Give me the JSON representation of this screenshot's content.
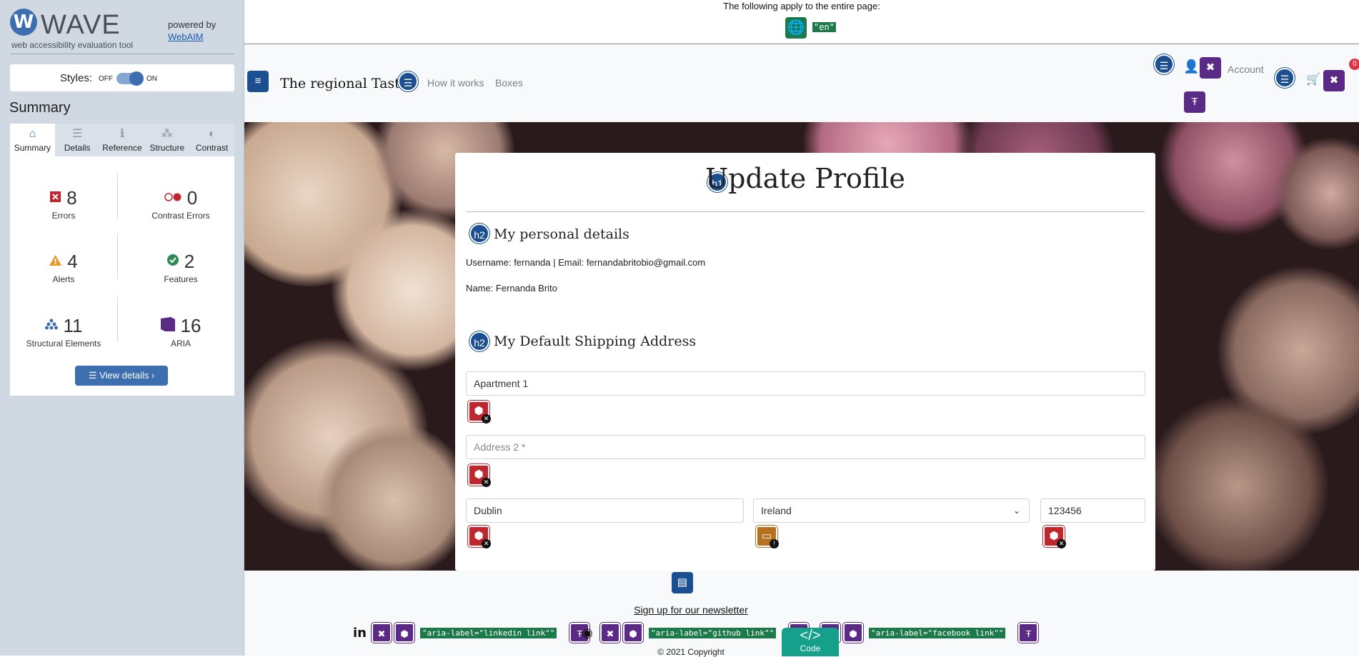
{
  "wave": {
    "logo_letter": "W",
    "logo_name": "WAVE",
    "tagline": "web accessibility evaluation tool",
    "powered_by": "powered by",
    "webaim_link": "WebAIM",
    "styles_label": "Styles:",
    "styles_off": "OFF",
    "styles_on": "ON",
    "summary_title": "Summary",
    "tabs": [
      {
        "label": "Summary",
        "icon": "home-icon"
      },
      {
        "label": "Details",
        "icon": "list-icon"
      },
      {
        "label": "Reference",
        "icon": "info-icon"
      },
      {
        "label": "Structure",
        "icon": "structure-icon"
      },
      {
        "label": "Contrast",
        "icon": "contrast-icon"
      }
    ],
    "stats": {
      "errors": {
        "value": "8",
        "label": "Errors"
      },
      "contrast_errors": {
        "value": "0",
        "label": "Contrast Errors"
      },
      "alerts": {
        "value": "4",
        "label": "Alerts"
      },
      "features": {
        "value": "2",
        "label": "Features"
      },
      "structural": {
        "value": "11",
        "label": "Structural Elements"
      },
      "aria": {
        "value": "16",
        "label": "ARIA"
      }
    },
    "view_details": "View details ›"
  },
  "page_level": {
    "text": "The following apply to the entire page:",
    "lang": "\"en\""
  },
  "nav": {
    "brand": "The regional Taste",
    "how_it_works": "How it works",
    "boxes": "Boxes",
    "account": "Account",
    "cart_count": "0"
  },
  "form": {
    "h1_tag": "h1",
    "h2_tag": "h2",
    "title": "Update Profile",
    "personal_heading": "My personal details",
    "username_line": "Username: fernanda | Email: fernandabritobio@gmail.com",
    "name_line": "Name: Fernanda Brito",
    "shipping_heading": "My Default Shipping Address",
    "address1_value": "Apartment 1",
    "address2_placeholder": "Address 2 *",
    "city_value": "Dublin",
    "country_value": "Ireland",
    "postcode_value": "123456"
  },
  "footer": {
    "newsletter": "Sign up for our newsletter",
    "linkedin_label": "\"aria-label=\"linkedin link\"\"",
    "github_label": "\"aria-label=\"github link\"\"",
    "facebook_label": "\"aria-label=\"facebook link\"\"",
    "copyright": "© 2021 Copyright",
    "code_button": "Code"
  },
  "colors": {
    "wave_blue": "#3d6fb0",
    "error_red": "#c0262d",
    "aria_purple": "#5b2a86",
    "feature_green": "#1c7a4a"
  }
}
